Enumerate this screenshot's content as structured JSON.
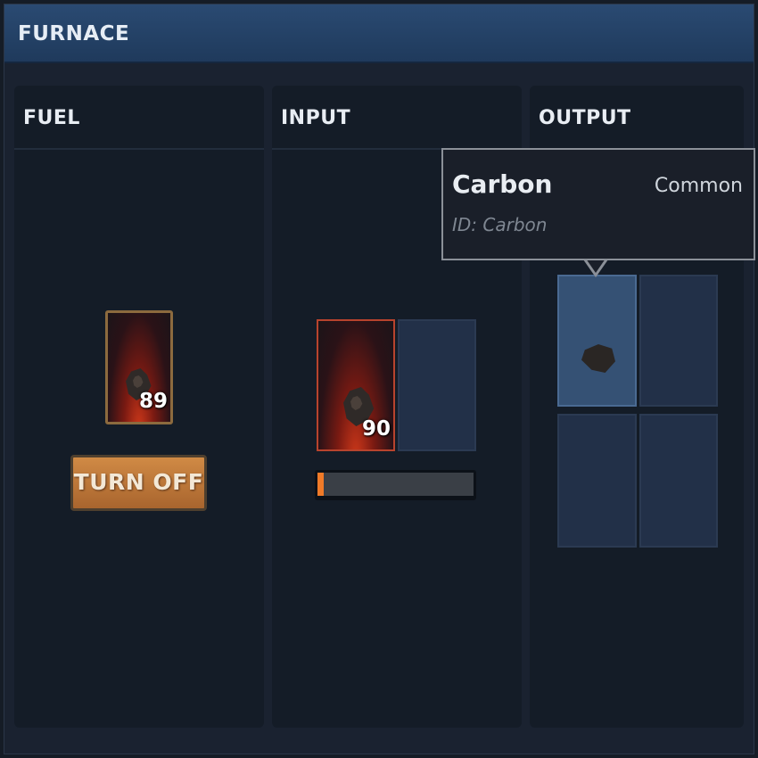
{
  "window": {
    "title": "FURNACE"
  },
  "panels": {
    "fuel": {
      "header": "FUEL"
    },
    "input": {
      "header": "INPUT"
    },
    "output": {
      "header": "OUTPUT"
    }
  },
  "fuel_slot": {
    "count": "89"
  },
  "toggle_button": {
    "label": "TURN OFF"
  },
  "input_slots": [
    {
      "count": "90"
    },
    {
      "count": ""
    }
  ],
  "progress": {
    "value": 0.04,
    "color": "#f07a28"
  },
  "output_slots": [
    {
      "item": "Carbon",
      "selected": true
    },
    {
      "item": ""
    },
    {
      "item": ""
    },
    {
      "item": ""
    }
  ],
  "tooltip": {
    "name": "Carbon",
    "rarity": "Common",
    "id": "ID: Carbon"
  },
  "colors": {
    "titlebar": "#2a4a72",
    "button": "#c07a3c",
    "selected_slot": "#355174"
  }
}
